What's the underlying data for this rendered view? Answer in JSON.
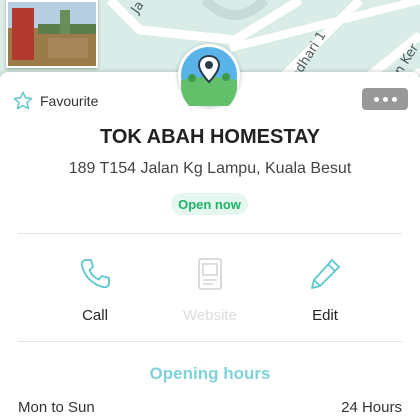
{
  "map": {
    "streets": [
      "Ja",
      "adhari 1",
      "n Ker"
    ]
  },
  "card": {
    "favourite_label": "Favourite",
    "title": "TOK ABAH HOMESTAY",
    "address": "189 T154 Jalan Kg Lampu, Kuala Besut",
    "status": "Open now",
    "status_color": "#1db46a"
  },
  "actions": {
    "call": "Call",
    "website": "Website",
    "edit": "Edit"
  },
  "hours": {
    "title": "Opening hours",
    "day": "Mon to Sun",
    "time": "24 Hours"
  },
  "icons": [
    "star-outline-icon",
    "more-dots-icon",
    "phone-icon",
    "website-icon",
    "pencil-icon",
    "place-location-icon"
  ],
  "colors": {
    "accent": "#7fd3d8",
    "map_bg": "#d9ece8"
  }
}
